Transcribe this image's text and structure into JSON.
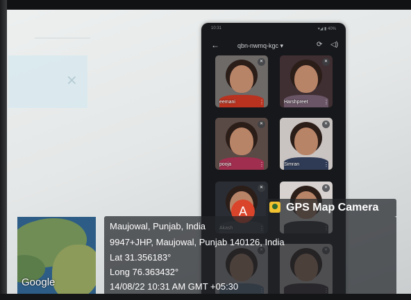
{
  "meeting": {
    "title": "qbn-nwmq-kgc ▾",
    "status_left": "10:31",
    "status_right": "▾◢ ▮ 40%",
    "participants": [
      {
        "name": "eemani",
        "shirt": "#b8321f",
        "bg": "#6d6a68"
      },
      {
        "name": "Harshpreet",
        "shirt": "#6a5566",
        "bg": "#3f2f33"
      },
      {
        "name": "pooja",
        "shirt": "#a02e4e",
        "bg": "#5a4a46"
      },
      {
        "name": "Simran",
        "shirt": "#2f3a55",
        "bg": "#c9c3c1"
      },
      {
        "name": "Akash",
        "shirt": "#3a3d43",
        "bg": "#2a2d33"
      },
      {
        "name": "",
        "shirt": "#2f3035",
        "bg": "#d7d2cf"
      },
      {
        "name": "",
        "shirt": "#5c6f8a",
        "bg": "#a8a7a5"
      },
      {
        "name": "",
        "shirt": "#3b2e2f",
        "bg": "#bfb6b3"
      }
    ],
    "avatar_letter": "A",
    "avatar_color": "#d9442b"
  },
  "stamp": {
    "app_name": "GPS Map Camera",
    "location": "Maujowal, Punjab, India",
    "address": "9947+JHP, Maujowal, Punjab 140126, India",
    "lat": "Lat 31.356183°",
    "long": "Long 76.363432°",
    "datetime": "14/08/22 10:31 AM GMT +05:30",
    "map_label": "Google"
  }
}
